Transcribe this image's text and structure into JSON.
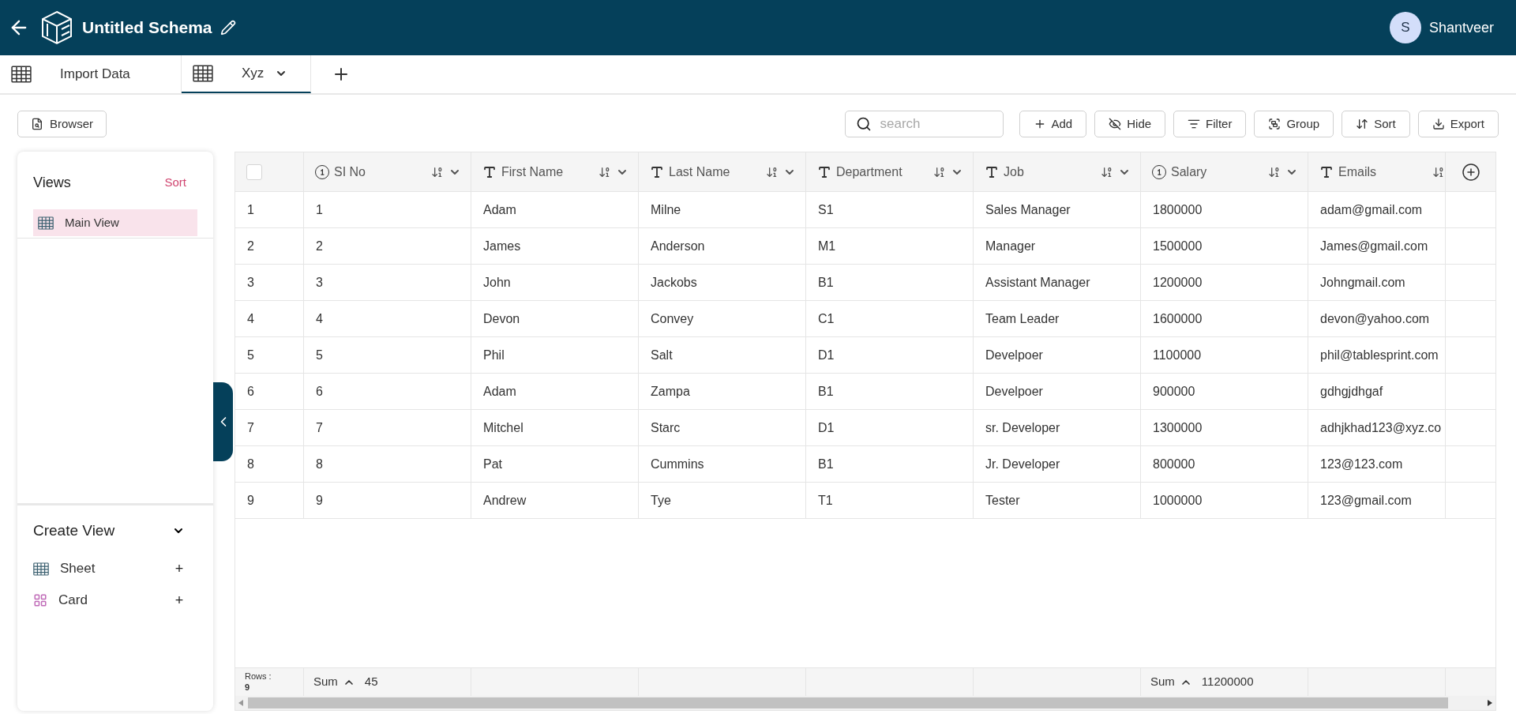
{
  "header": {
    "title": "Untitled Schema",
    "user": {
      "initial": "S",
      "name": "Shantveer"
    }
  },
  "tabs": [
    {
      "label": "Import Data",
      "selected": false,
      "dropdown": false
    },
    {
      "label": "Xyz",
      "selected": true,
      "dropdown": true
    }
  ],
  "toolbar": {
    "browser": "Browser",
    "search_placeholder": "search",
    "buttons": [
      {
        "kind": "add",
        "label": "Add"
      },
      {
        "kind": "hide",
        "label": "Hide"
      },
      {
        "kind": "filter",
        "label": "Filter"
      },
      {
        "kind": "group",
        "label": "Group"
      },
      {
        "kind": "sort",
        "label": "Sort"
      },
      {
        "kind": "export",
        "label": "Export"
      }
    ]
  },
  "views": {
    "title": "Views",
    "sort": "Sort",
    "items": [
      {
        "label": "Main View",
        "selected": true
      }
    ]
  },
  "create_view": {
    "title": "Create View",
    "items": [
      {
        "kind": "sheet",
        "label": "Sheet",
        "plus": "+"
      },
      {
        "kind": "card",
        "label": "Card",
        "plus": "+"
      }
    ]
  },
  "table": {
    "columns": [
      {
        "label": "SI No",
        "kind": "number"
      },
      {
        "label": "First Name",
        "kind": "text"
      },
      {
        "label": "Last Name",
        "kind": "text"
      },
      {
        "label": "Department",
        "kind": "text"
      },
      {
        "label": "Job",
        "kind": "text"
      },
      {
        "label": "Salary",
        "kind": "number"
      },
      {
        "label": "Emails",
        "kind": "text"
      }
    ],
    "select_all_checked": false,
    "rows": [
      {
        "number": "1",
        "cells": [
          "1",
          "Adam",
          "Milne",
          "S1",
          "Sales Manager",
          "1800000",
          "adam@gmail.com"
        ]
      },
      {
        "number": "2",
        "cells": [
          "2",
          "James",
          "Anderson",
          "M1",
          "Manager",
          "1500000",
          "James@gmail.com"
        ]
      },
      {
        "number": "3",
        "cells": [
          "3",
          "John",
          "Jackobs",
          "B1",
          "Assistant Manager",
          "1200000",
          "Johngmail.com"
        ]
      },
      {
        "number": "4",
        "cells": [
          "4",
          "Devon",
          "Convey",
          "C1",
          "Team Leader",
          "1600000",
          "devon@yahoo.com"
        ]
      },
      {
        "number": "5",
        "cells": [
          "5",
          "Phil",
          "Salt",
          "D1",
          "Develpoer",
          "1100000",
          "phil@tablesprint.com"
        ]
      },
      {
        "number": "6",
        "cells": [
          "6",
          "Adam",
          "Zampa",
          "B1",
          "Develpoer",
          "900000",
          "gdhgjdhgaf"
        ]
      },
      {
        "number": "7",
        "cells": [
          "7",
          "Mitchel",
          "Starc",
          "D1",
          "sr. Developer",
          "1300000",
          "adhjkhad123@xyz.co"
        ]
      },
      {
        "number": "8",
        "cells": [
          "8",
          "Pat",
          "Cummins",
          "B1",
          "Jr. Developer",
          "800000",
          "123@123.com"
        ]
      },
      {
        "number": "9",
        "cells": [
          "9",
          "Andrew",
          "Tye",
          "T1",
          "Tester",
          "1000000",
          "123@gmail.com"
        ]
      }
    ],
    "footer": {
      "rows_label": "Rows :",
      "rows_count": "9",
      "cells": [
        {
          "label": "Sum",
          "value": "45"
        },
        {},
        {},
        {},
        {},
        {
          "label": "Sum",
          "value": "11200000"
        },
        {}
      ]
    }
  }
}
